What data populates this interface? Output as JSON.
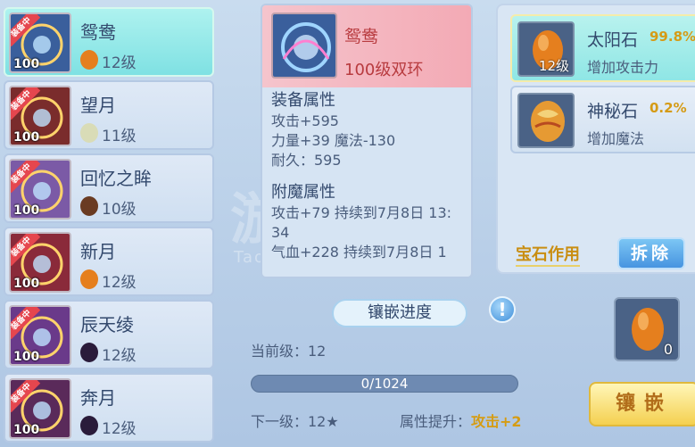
{
  "watermark": "游手游",
  "watermark_sub": "TaoYou",
  "equipped_tag": "装备中",
  "items": [
    {
      "name": "鸳鸯",
      "level": "100",
      "gem_level": "12级",
      "gem_color": "#e57f1e",
      "selected": true,
      "equipped": true
    },
    {
      "name": "望月",
      "level": "100",
      "gem_level": "11级",
      "gem_color": "#d9dcb7",
      "selected": false,
      "equipped": true
    },
    {
      "name": "回忆之眸",
      "level": "100",
      "gem_level": "10级",
      "gem_color": "#6a3b22",
      "selected": false,
      "equipped": true
    },
    {
      "name": "新月",
      "level": "100",
      "gem_level": "12级",
      "gem_color": "#e57f1e",
      "selected": false,
      "equipped": true
    },
    {
      "name": "辰天绫",
      "level": "100",
      "gem_level": "12级",
      "gem_color": "#2a1b3a",
      "selected": false,
      "equipped": true
    },
    {
      "name": "奔月",
      "level": "100",
      "gem_level": "12级",
      "gem_color": "#2a1b3a",
      "selected": false,
      "equipped": true
    }
  ],
  "detail": {
    "name": "鸳鸯",
    "level_text": "100级双环",
    "equip_attr_title": "装备属性",
    "equip_attrs": [
      "攻击+595",
      "力量+39 魔法-130",
      "耐久：595"
    ],
    "enchant_title": "附魔属性",
    "enchant_attrs": [
      "攻击+79 持续到7月8日 13:",
      "34",
      "气血+228 持续到7月8日 1"
    ]
  },
  "stones": [
    {
      "name": "太阳石",
      "percent": "99.8%",
      "desc": "增加攻击力",
      "level": "12级",
      "selected": true,
      "color": "#e57f1e"
    },
    {
      "name": "神秘石",
      "percent": "0.2%",
      "desc": "增加魔法",
      "level": "",
      "selected": false,
      "color": "#e6a33a"
    }
  ],
  "effect_label": "宝石作用",
  "remove_button": "拆除",
  "progress_title": "镶嵌进度",
  "hint_icon": "!",
  "current_level": "当前级：12",
  "progress": {
    "text": "0/1024",
    "value": 0,
    "max": 1024
  },
  "next_level": "下一级：12★",
  "attr_label": "属性提升：",
  "attr_value": "攻击+2",
  "gem_slot_count": "0",
  "inlay_button": "镶嵌"
}
